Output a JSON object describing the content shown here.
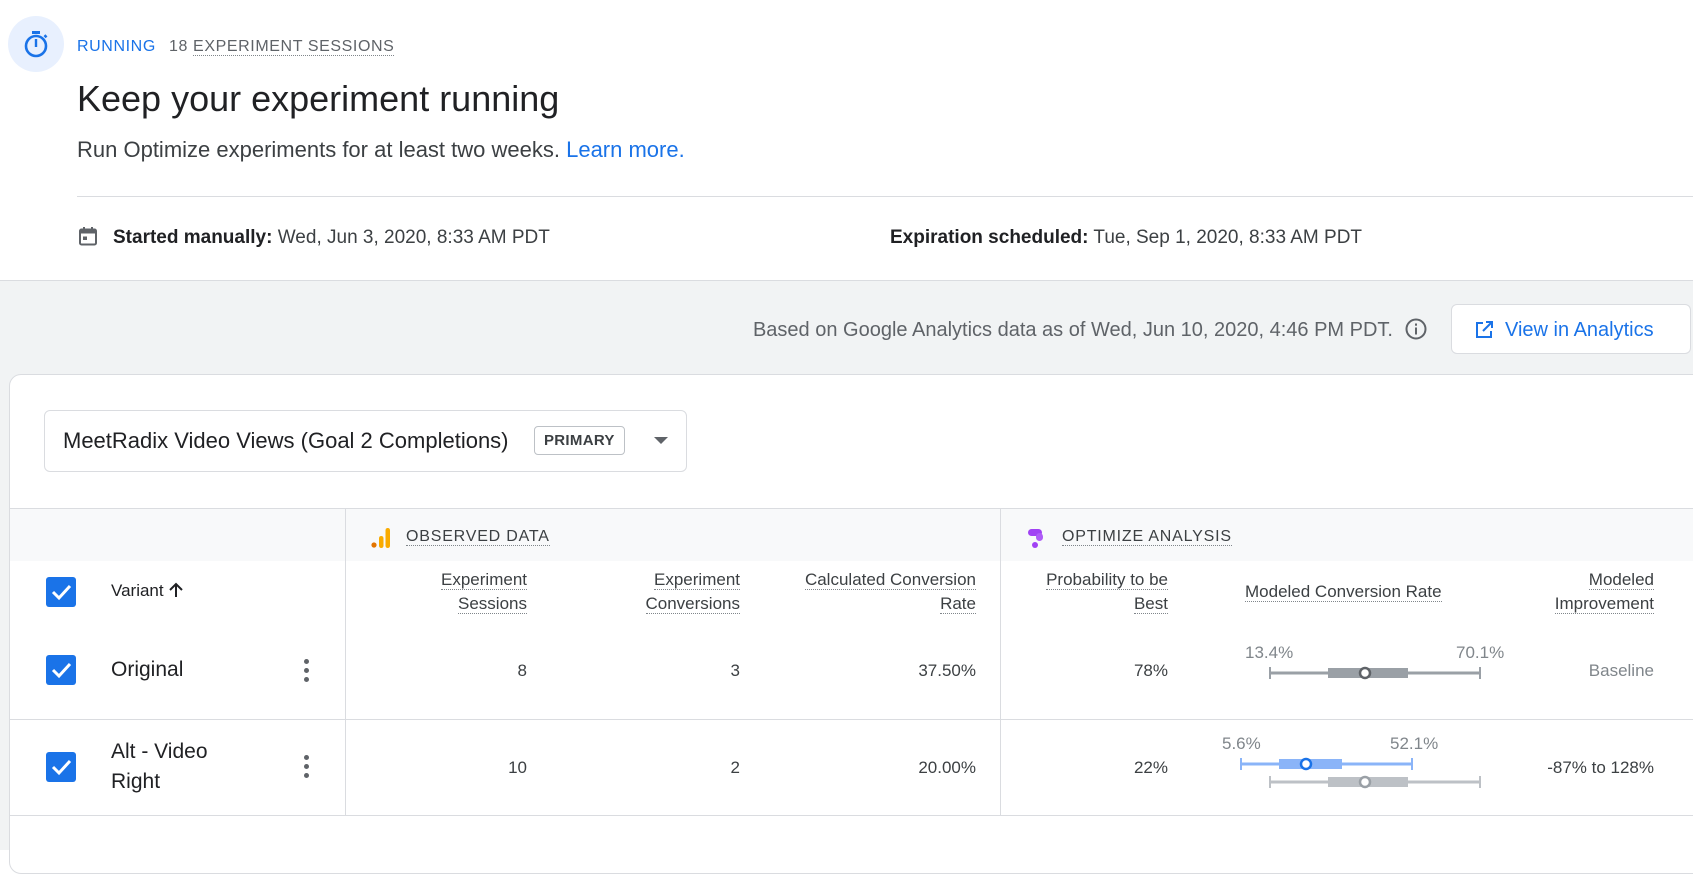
{
  "header": {
    "status": "RUNNING",
    "sessions_count": "18",
    "sessions_label": "EXPERIMENT SESSIONS",
    "title": "Keep your experiment running",
    "subtitle": "Run Optimize experiments for at least two weeks.",
    "learn_more": "Learn more.",
    "started_label": "Started manually:",
    "started_value": "Wed, Jun 3, 2020, 8:33 AM PDT",
    "expiry_label": "Expiration scheduled:",
    "expiry_value": "Tue, Sep 1, 2020, 8:33 AM PDT",
    "icon": "timer-icon"
  },
  "report": {
    "based_on": "Based on Google Analytics data as of Wed, Jun 10, 2020, 4:46 PM PDT.",
    "view_button": "View in Analytics",
    "objective": "MeetRadix Video Views (Goal 2 Completions)",
    "objective_badge": "PRIMARY"
  },
  "table": {
    "group_observed": "OBSERVED DATA",
    "group_optimize": "OPTIMIZE ANALYSIS",
    "columns": {
      "variant": "Variant",
      "sessions_1": "Experiment",
      "sessions_2": "Sessions",
      "conversions_1": "Experiment",
      "conversions_2": "Conversions",
      "rate_1": "Calculated Conversion",
      "rate_2": "Rate",
      "prob_1": "Probability to be",
      "prob_2": "Best",
      "modeled_rate": "Modeled Conversion Rate",
      "improvement_1": "Modeled",
      "improvement_2": "Improvement"
    },
    "rows": [
      {
        "name": "Original",
        "sessions": "8",
        "conversions": "3",
        "rate": "37.50%",
        "probability": "78%",
        "ci_low": "13.4%",
        "ci_high": "70.1%",
        "improvement": "Baseline"
      },
      {
        "name_1": "Alt - Video",
        "name_2": "Right",
        "sessions": "10",
        "conversions": "2",
        "rate": "20.00%",
        "probability": "22%",
        "ci_low": "5.6%",
        "ci_high": "52.1%",
        "improvement": "-87% to 128%"
      }
    ]
  },
  "colors": {
    "accent": "#1a73e8",
    "ci_original": "#9aa0a6",
    "ci_variant": "#8ab4f8",
    "ci_baseline_light": "#bdc1c6"
  }
}
